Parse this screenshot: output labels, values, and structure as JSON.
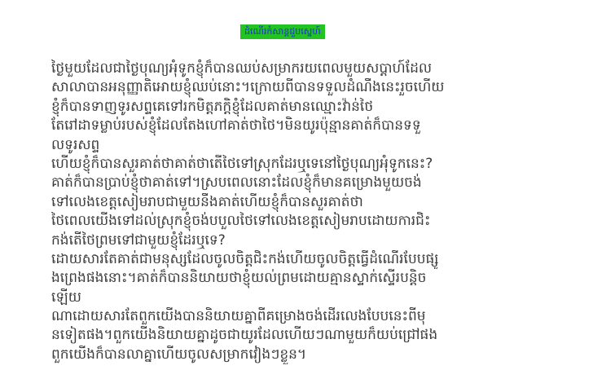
{
  "document": {
    "title": "ដំណើរកំសាន្តជួបស្នេហ៍",
    "lines": [
      "ថ្ងៃមួយដែលជាថ្ងៃបុណ្យអុំទូកខ្ញុំក៏បានឈប់សម្រាករយពេលមួយសប្តាហ៍ដែល",
      "សាលាបានអនុញ្ញាតិអោយខ្ញុំឈប់នោះ។ក្រោយពីបានទទួលដំណឹងនេះរួចហើយ",
      "ខ្ញុំក៏បានទាញទូរសព្ទគេទៅរកមិត្តភក្តិខ្ញុំដែលគាត់មានឈ្មោះវ៉ាន់ថៃ",
      "តែរៅដាទម្លាប់របស់ខ្ញុំដែលតែងហៅគាត់ថាថៃ។មិនយូរប៉ុន្មានគាត់ក៏បានទទួ",
      "លទូរសព្ទ",
      "ហើយខ្ញុំក៏បានសួរគាត់ថាគាត់ថាតើថៃទៅស្រុកដែរឬទេនៅថ្ងៃបុណ្យអុំទូកនេះ?",
      "គាត់ក៏បានប្រាប់ខ្ញុំថាគាត់ទៅ។ស្របពេលនោះដែលខ្ញុំក៏មានគម្រោងមួយចង់",
      "ទៅលេងខេត្តសៀមរាបជាមួយនឹងគាត់ហើយខ្ញុំក៏បានសួរគាត់ថា",
      "ថៃពេលយើងទៅដល់ស្រុកខ្ញុំចង់បបួលថៃទៅលេងខេត្តសៀមរាបដោយការជិះ",
      "កង់តើថៃព្រមទៅជាមួយខ្ញុំដែរឬទេ?",
      "ដោយសារតែគាត់ជាមនុស្សដែលចូលចិត្តជិះកង់ហើយចូលចិត្តធ្វើដំណើរបែបផ្សូ",
      "ងព្រេងផងនោះ។គាត់ក៏បាននិយាយថាខ្ញុំយល់ព្រមដោយគ្មានស្ទាក់ស្ទើរបន្តិច",
      "ឡើយ",
      "ណាដោយសារតែពួកយើងបាននិយាយគ្នាពីគម្រោងចង់ដើរលេងបែបនេះពីមុ",
      "នទៀតផង។ពួកយើងនិយាយគ្នាដូចជាយូរដែលហើយៗណាមួយក៏យប់ជ្រៅផង",
      "ពួកយើងក៏បានលាគ្នាហើយចូលសម្រាកវៀងៗខ្លួន។"
    ]
  },
  "colors": {
    "title_background": "#24c324",
    "title_text": "#1a2fd6",
    "body_text": "#3b3b3b",
    "page_background": "#ffffff"
  }
}
